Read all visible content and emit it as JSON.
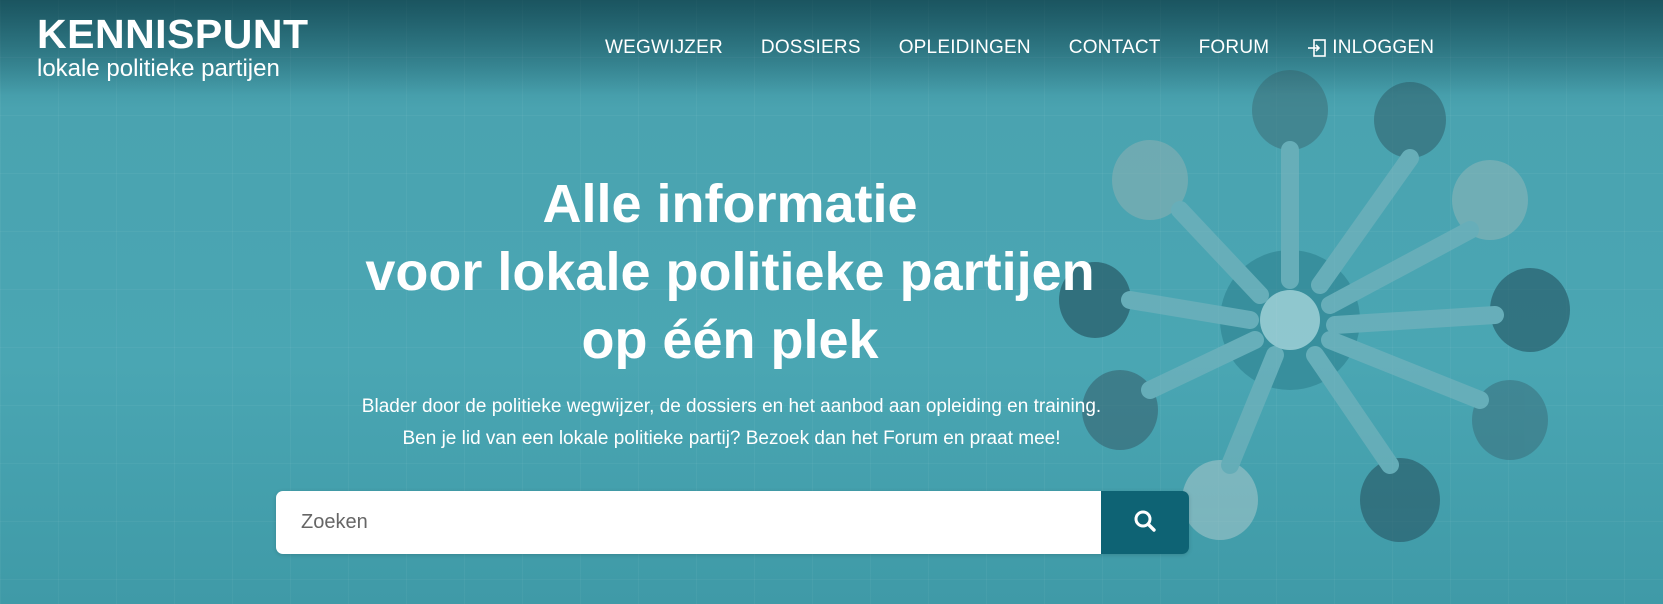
{
  "brand": {
    "title": "KENNISPUNT",
    "subtitle": "lokale politieke partijen"
  },
  "nav": {
    "items": [
      "WEGWIJZER",
      "DOSSIERS",
      "OPLEIDINGEN",
      "CONTACT",
      "FORUM"
    ],
    "login": {
      "label": "INLOGGEN",
      "icon": "login-icon"
    }
  },
  "hero": {
    "headline": [
      "Alle informatie",
      "voor lokale politieke partijen",
      "op één plek"
    ],
    "intro": [
      "Blader door de politieke wegwijzer, de dossiers en het aanbod aan opleiding en training.",
      "Ben je lid van een lokale politieke partij? Bezoek dan het Forum en praat mee!"
    ]
  },
  "search": {
    "placeholder": "Zoeken",
    "value": "",
    "button_icon": "search-icon"
  },
  "colors": {
    "overlay": "#4aa6b3",
    "search_button": "#0e6374",
    "text": "#ffffff"
  }
}
